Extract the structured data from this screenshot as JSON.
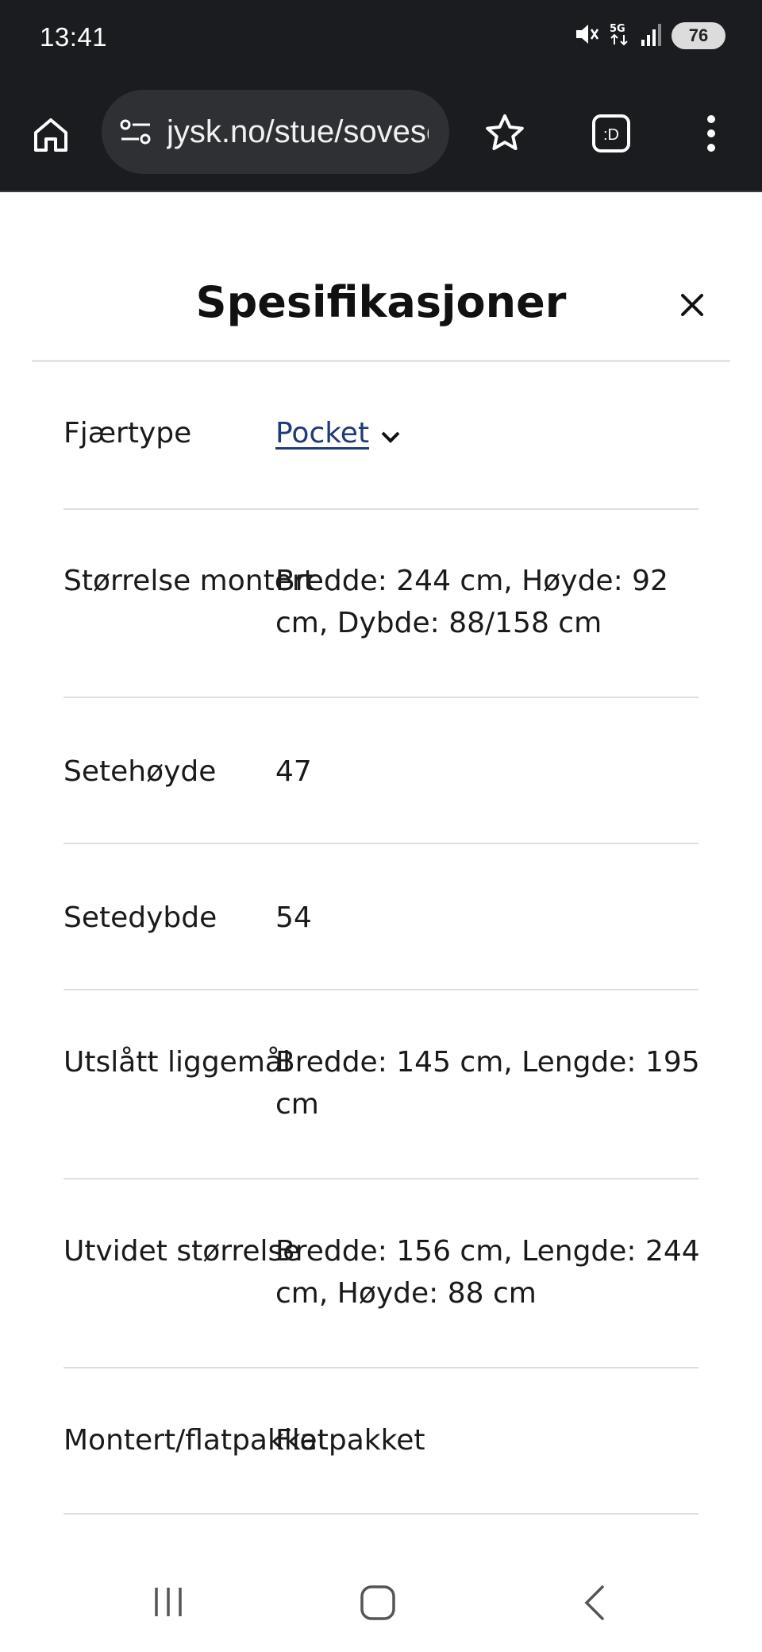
{
  "status_bar": {
    "time": "13:41",
    "battery": "76",
    "icons": [
      "mute-icon",
      "5g-icon",
      "signal-icon",
      "battery-icon"
    ]
  },
  "browser": {
    "url": "jysk.no/stue/sovesofaer",
    "icons": [
      "home-icon",
      "site-settings-icon",
      "star-icon",
      "tabs-icon",
      "more-vert-icon"
    ],
    "tabs_label": ":D"
  },
  "modal": {
    "title": "Spesifikasjoner",
    "close_icon": "close-icon",
    "specs": [
      {
        "label": "Fjærtype",
        "value": "Pocket",
        "is_link": true
      },
      {
        "label": "Størrelse montert",
        "value": "Bredde: 244 cm, Høyde: 92 cm, Dybde: 88/158 cm"
      },
      {
        "label": "Setehøyde",
        "value": "47"
      },
      {
        "label": "Setedybde",
        "value": "54"
      },
      {
        "label": "Utslått liggemål",
        "value": "Bredde: 145 cm, Lengde: 195 cm"
      },
      {
        "label": "Utvidet størrelse",
        "value": "Bredde: 156 cm, Lengde: 244 cm, Høyde: 88 cm"
      },
      {
        "label": "Montert/flatpakket",
        "value": "Flatpakket"
      }
    ]
  },
  "nav_bar": {
    "icons": [
      "recent-apps-icon",
      "home-circle-icon",
      "back-icon"
    ]
  },
  "colors": {
    "chrome_bg": "#1b1c1f",
    "url_pill": "#2e3034",
    "link": "#1d3b78",
    "divider": "#dedede"
  }
}
